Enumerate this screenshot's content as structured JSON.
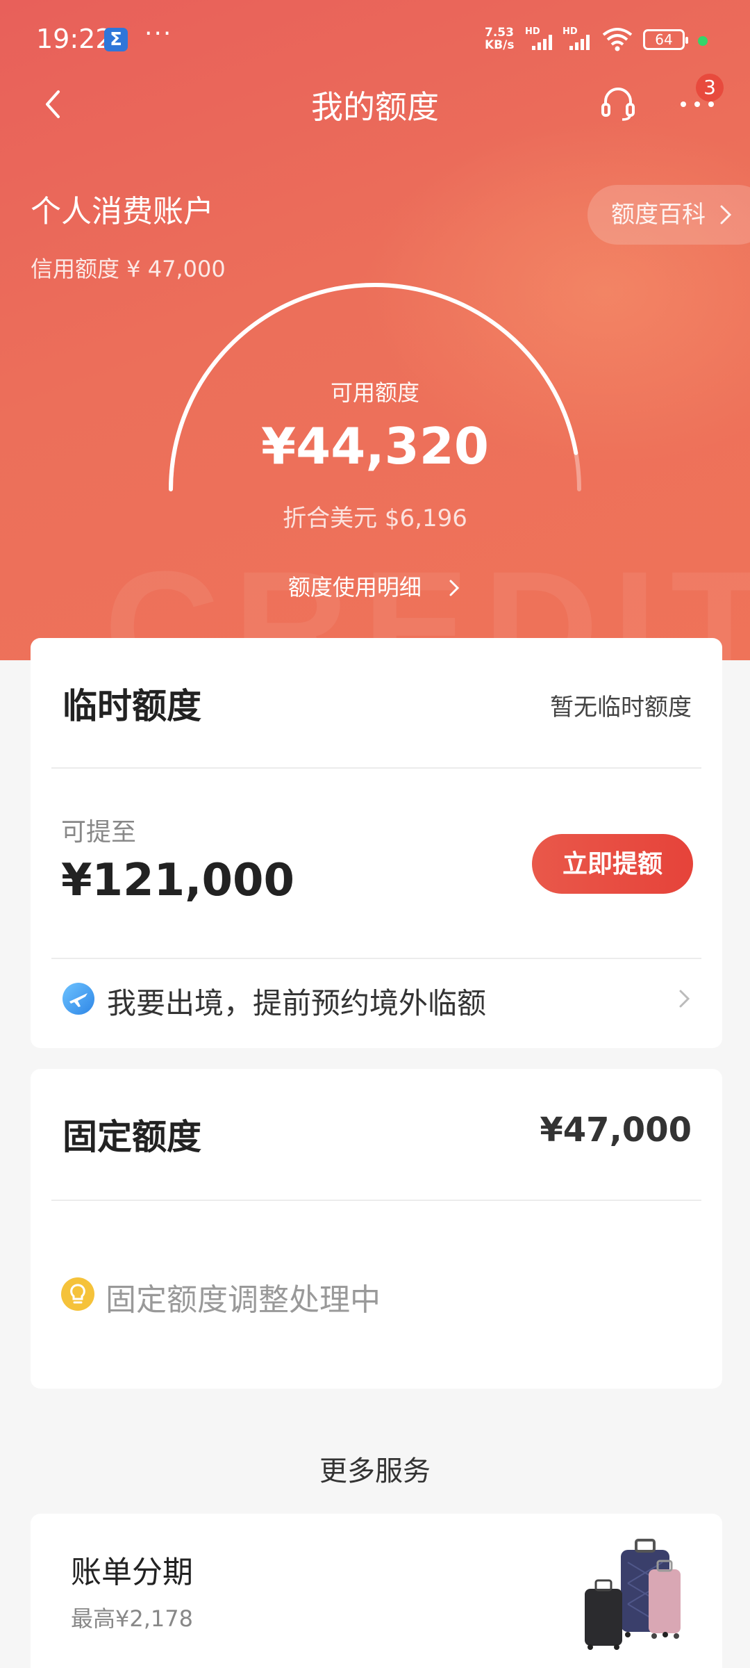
{
  "status_bar": {
    "time": "19:22",
    "app_icon_glyph": "Σ",
    "dots": "···",
    "net_speed_value": "7.53",
    "net_speed_unit": "KB/s",
    "sim1_label": "HD",
    "sim2_label": "HD",
    "battery": "64"
  },
  "nav": {
    "title": "我的额度",
    "badge_count": "3"
  },
  "account": {
    "name": "个人消费账户",
    "credit_limit": "信用额度 ¥ 47,000",
    "wiki_button": "额度百科"
  },
  "gauge": {
    "available_label": "可用额度",
    "available_value": "¥44,320",
    "usd_value": "折合美元 $6,196",
    "usage_detail_link": "额度使用明细",
    "used_fraction": 0.057
  },
  "watermark": "CREDIT",
  "temp_quota": {
    "title": "临时额度",
    "status": "暂无临时额度",
    "can_raise_label": "可提至",
    "can_raise_value": "¥121,000",
    "raise_button": "立即提额",
    "travel_link": "我要出境，提前预约境外临额"
  },
  "fixed_quota": {
    "title": "固定额度",
    "amount": "¥47,000",
    "adjust_status": "固定额度调整处理中"
  },
  "more_services": {
    "heading": "更多服务",
    "installment_title": "账单分期",
    "installment_subtitle": "最高¥2,178"
  },
  "colors": {
    "hero": "#E9625A",
    "accent_button": "#E6473C",
    "badge": "#E84A3D"
  },
  "icons": [
    "back-icon",
    "headset-icon",
    "more-icon",
    "chevron-right-icon",
    "plane-icon",
    "bulb-icon",
    "luggage-icon",
    "wifi-icon",
    "signal-icon",
    "battery-icon"
  ]
}
